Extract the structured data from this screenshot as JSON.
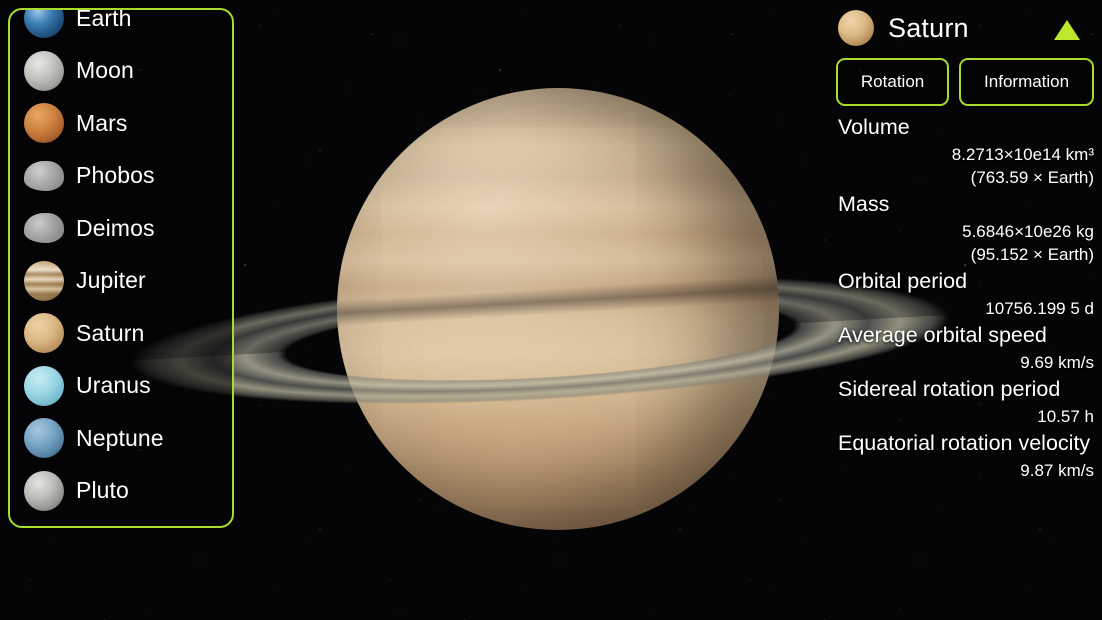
{
  "app": {
    "accent_green": "#a9dc2b",
    "arrow_green": "#b9e82c",
    "background": "#050507"
  },
  "sidebar": {
    "items": [
      {
        "label": "Earth",
        "icon": "earth-thumb",
        "thumb_class": "t-earth",
        "shape": "sphere"
      },
      {
        "label": "Moon",
        "icon": "moon-thumb",
        "thumb_class": "t-moon",
        "shape": "sphere"
      },
      {
        "label": "Mars",
        "icon": "mars-thumb",
        "thumb_class": "t-mars",
        "shape": "sphere"
      },
      {
        "label": "Phobos",
        "icon": "phobos-thumb",
        "thumb_class": "t-phobos",
        "shape": "irregular"
      },
      {
        "label": "Deimos",
        "icon": "deimos-thumb",
        "thumb_class": "t-deimos",
        "shape": "irregular"
      },
      {
        "label": "Jupiter",
        "icon": "jupiter-thumb",
        "thumb_class": "t-jupiter",
        "shape": "sphere"
      },
      {
        "label": "Saturn",
        "icon": "saturn-thumb",
        "thumb_class": "t-saturn",
        "shape": "sphere"
      },
      {
        "label": "Uranus",
        "icon": "uranus-thumb",
        "thumb_class": "t-uranus",
        "shape": "sphere"
      },
      {
        "label": "Neptune",
        "icon": "neptune-thumb",
        "thumb_class": "t-neptune",
        "shape": "sphere"
      },
      {
        "label": "Pluto",
        "icon": "pluto-thumb",
        "thumb_class": "t-pluto",
        "shape": "sphere"
      }
    ]
  },
  "info": {
    "title": "Saturn",
    "title_icon": "saturn-thumb",
    "collapse_icon": "triangle-up-icon",
    "tabs": [
      {
        "label": "Rotation"
      },
      {
        "label": "Information"
      }
    ],
    "rows": [
      {
        "label": "Volume",
        "values": [
          "8.2713×10e14 km³",
          "(763.59 × Earth)"
        ]
      },
      {
        "label": "Mass",
        "values": [
          "5.6846×10e26 kg",
          "(95.152 × Earth)"
        ]
      },
      {
        "label": "Orbital period",
        "values": [
          "10756.199 5 d"
        ]
      },
      {
        "label": "Average orbital speed",
        "values": [
          "9.69 km/s"
        ]
      },
      {
        "label": "Sidereal rotation period",
        "values": [
          "10.57 h"
        ]
      },
      {
        "label": "Equatorial rotation velocity",
        "values": [
          "9.87 km/s"
        ]
      }
    ]
  },
  "scene": {
    "object_name": "saturn-planet",
    "rings_name": "saturn-rings"
  }
}
